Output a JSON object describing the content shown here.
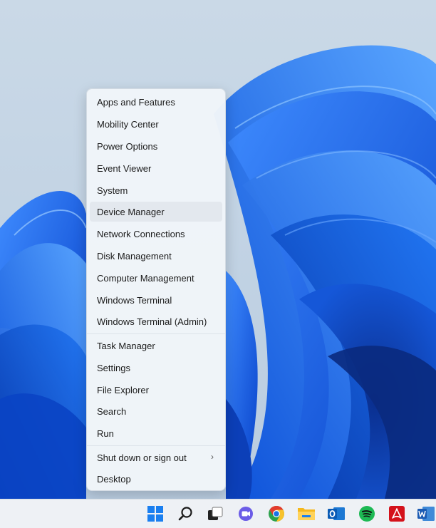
{
  "menu": {
    "items": [
      {
        "label": "Apps and Features"
      },
      {
        "label": "Mobility Center"
      },
      {
        "label": "Power Options"
      },
      {
        "label": "Event Viewer"
      },
      {
        "label": "System"
      },
      {
        "label": "Device Manager"
      },
      {
        "label": "Network Connections"
      },
      {
        "label": "Disk Management"
      },
      {
        "label": "Computer Management"
      },
      {
        "label": "Windows Terminal"
      },
      {
        "label": "Windows Terminal (Admin)"
      },
      {
        "label": "Task Manager"
      },
      {
        "label": "Settings"
      },
      {
        "label": "File Explorer"
      },
      {
        "label": "Search"
      },
      {
        "label": "Run"
      },
      {
        "label": "Shut down or sign out"
      },
      {
        "label": "Desktop"
      }
    ],
    "hovered_item": "Device Manager"
  },
  "taskbar": {
    "icons": [
      "start-icon",
      "search-icon",
      "task-view-icon",
      "teams-chat-icon",
      "chrome-icon",
      "file-explorer-icon",
      "outlook-icon",
      "spotify-icon",
      "acrobat-icon",
      "word-icon"
    ]
  },
  "colors": {
    "accent": "#0a63d8",
    "menu_bg": "#f1f5f9",
    "taskbar_bg": "#eef1f5"
  }
}
